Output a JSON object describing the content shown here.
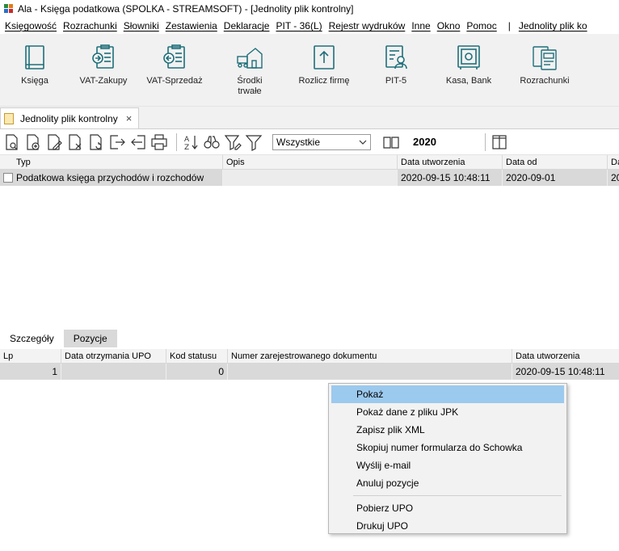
{
  "window": {
    "title": "Ala - Księga podatkowa (SPOLKA - STREAMSOFT) - [Jednolity plik kontrolny]"
  },
  "menu": [
    "Księgowość",
    "Rozrachunki",
    "Słowniki",
    "Zestawienia",
    "Deklaracje",
    "PIT - 36(L)",
    "Rejestr wydruków",
    "Inne",
    "Okno",
    "Pomoc",
    "Jednolity plik ko"
  ],
  "menu_separator": "|",
  "ribbon": [
    {
      "label": "Księga",
      "icon": "book-icon"
    },
    {
      "label": "VAT-Zakupy",
      "icon": "vat-purchase-icon"
    },
    {
      "label": "VAT-Sprzedaż",
      "icon": "vat-sales-icon"
    },
    {
      "label": "Środki trwałe",
      "icon": "fixed-assets-icon"
    },
    {
      "label": "Rozlicz firmę",
      "icon": "settle-company-icon"
    },
    {
      "label": "PIT-5",
      "icon": "pit5-icon"
    },
    {
      "label": "Kasa, Bank",
      "icon": "safe-icon"
    },
    {
      "label": "Rozrachunki",
      "icon": "settlements-icon"
    }
  ],
  "document_tab": {
    "label": "Jednolity plik kontrolny",
    "close": "×"
  },
  "toolbar": {
    "filter_value": "Wszystkie",
    "year": "2020",
    "sort_label_top": "A",
    "sort_label_bottom": "Z"
  },
  "main_grid": {
    "columns": [
      "Typ",
      "Opis",
      "Data utworzenia",
      "Data od",
      "Da"
    ],
    "rows": [
      [
        "Podatkowa księga przychodów i rozchodów",
        "",
        "2020-09-15 10:48:11",
        "2020-09-01",
        "20"
      ]
    ]
  },
  "lower_tabs": [
    "Szczegóły",
    "Pozycje"
  ],
  "detail_grid": {
    "columns": [
      "Lp",
      "Data otrzymania UPO",
      "Kod statusu",
      "Numer zarejestrowanego dokumentu",
      "Data utworzenia"
    ],
    "rows": [
      [
        "1",
        "",
        "0",
        "",
        "2020-09-15 10:48:11"
      ]
    ]
  },
  "context_menu": {
    "group1": [
      "Pokaż",
      "Pokaż dane z pliku JPK",
      "Zapisz plik XML",
      "Skopiuj numer formularza do Schowka",
      "Wyślij e-mail",
      "Anuluj pozycje"
    ],
    "group2": [
      "Pobierz UPO",
      "Drukuj UPO"
    ]
  },
  "colors": {
    "highlight": "#9cc9ee",
    "ribbon_icon": "#1f6f7a",
    "row_selected": "#d9d9d9"
  }
}
